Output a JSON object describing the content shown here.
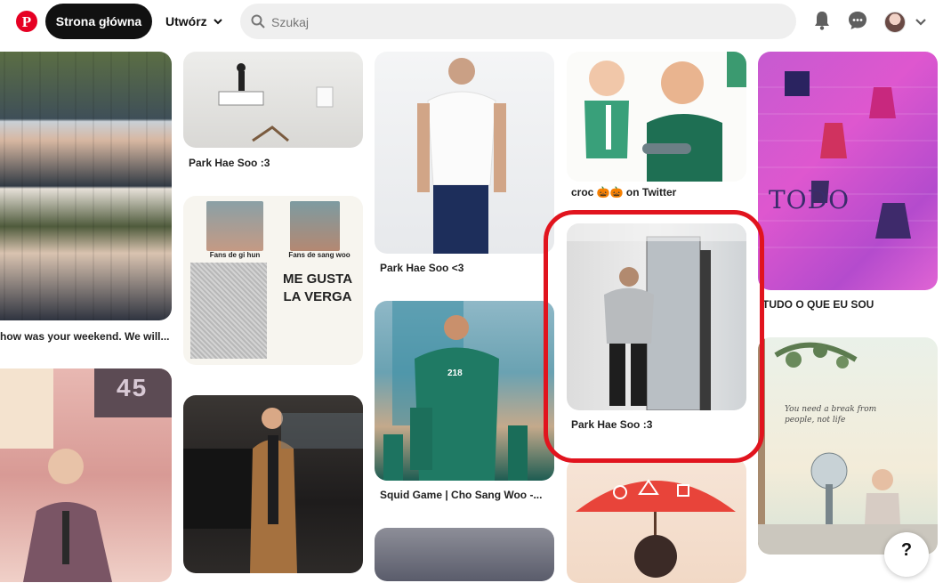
{
  "header": {
    "home_label": "Strona główna",
    "create_label": "Utwórz",
    "search_placeholder": "Szukaj",
    "icons": [
      "pinterest-logo-icon",
      "chevron-down-icon",
      "search-icon",
      "bell-icon",
      "chat-icon",
      "avatar",
      "chevron-down-icon"
    ]
  },
  "pins": [
    {
      "caption": "how was your weekend. We will..."
    },
    {
      "caption": "Park Hae Soo :3"
    },
    {
      "caption": "Park Hae Soo <3"
    },
    {
      "caption": "croc 🎃🎃 on Twitter"
    },
    {
      "caption": "TUDO O QUE EU SOU"
    },
    {
      "caption": "Park Hae Soo :3"
    },
    {
      "caption": "Squid Game | Cho Sang Woo -..."
    }
  ],
  "meme": {
    "left_label": "Fans de gi hun",
    "right_label": "Fans de sang woo",
    "text": "ME GUSTA LA VERGA"
  },
  "squid_number": "218",
  "card_number": "45",
  "watercolor_text": "You need a break from people, not life",
  "pink_drawing_text": "TODO",
  "accent": {
    "brand": "#e60023",
    "highlight": "#e1141e"
  },
  "help_label": "?"
}
